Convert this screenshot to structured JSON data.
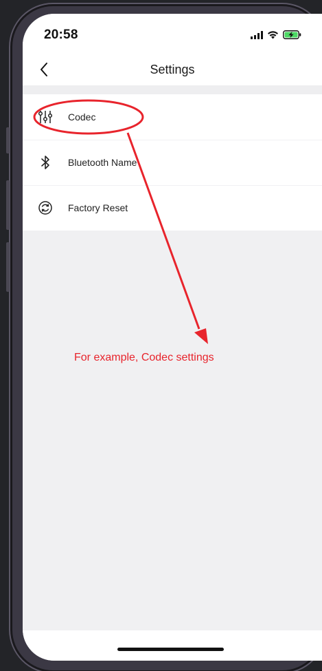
{
  "status_bar": {
    "time": "20:58",
    "icons": [
      "signal-icon",
      "wifi-icon",
      "battery-charging-icon"
    ]
  },
  "nav": {
    "back_icon": "chevron-left-icon",
    "title": "Settings"
  },
  "settings": {
    "items": [
      {
        "icon": "sliders-icon",
        "label": "Codec"
      },
      {
        "icon": "bluetooth-icon",
        "label": "Bluetooth Name"
      },
      {
        "icon": "reset-icon",
        "label": "Factory Reset"
      }
    ]
  },
  "annotation": {
    "text": "For example, Codec settings",
    "color": "#e8242c"
  },
  "colors": {
    "accent_battery": "#4cd964",
    "annotation_red": "#e8242c"
  }
}
